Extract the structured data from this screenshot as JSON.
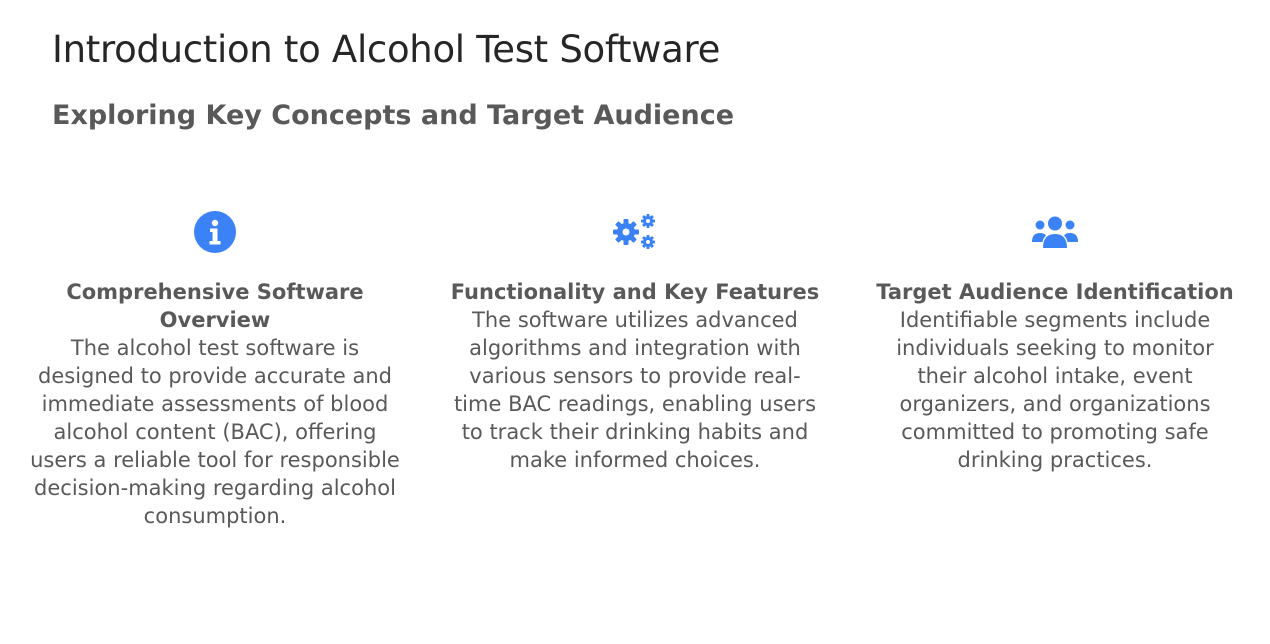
{
  "slide": {
    "title": "Introduction to Alcohol Test Software",
    "subtitle": "Exploring Key Concepts and Target Audience"
  },
  "colors": {
    "accent": "#3b82f6",
    "text": "#595959",
    "title": "#262626"
  },
  "columns": [
    {
      "icon": "info-circle-icon",
      "heading": "Comprehensive Software Overview",
      "body": "The alcohol test software is designed to provide accurate and immediate assessments of blood alcohol content (BAC), offering users a reliable tool for responsible decision-making regarding alcohol consumption."
    },
    {
      "icon": "gears-icon",
      "heading": "Functionality and Key Features",
      "body": "The software utilizes advanced algorithms and integration with various sensors to provide real-time BAC readings, enabling users to track their drinking habits and make informed choices."
    },
    {
      "icon": "users-icon",
      "heading": "Target Audience Identification",
      "body": "Identifiable segments include individuals seeking to monitor their alcohol intake, event organizers, and organizations committed to promoting safe drinking practices."
    }
  ]
}
